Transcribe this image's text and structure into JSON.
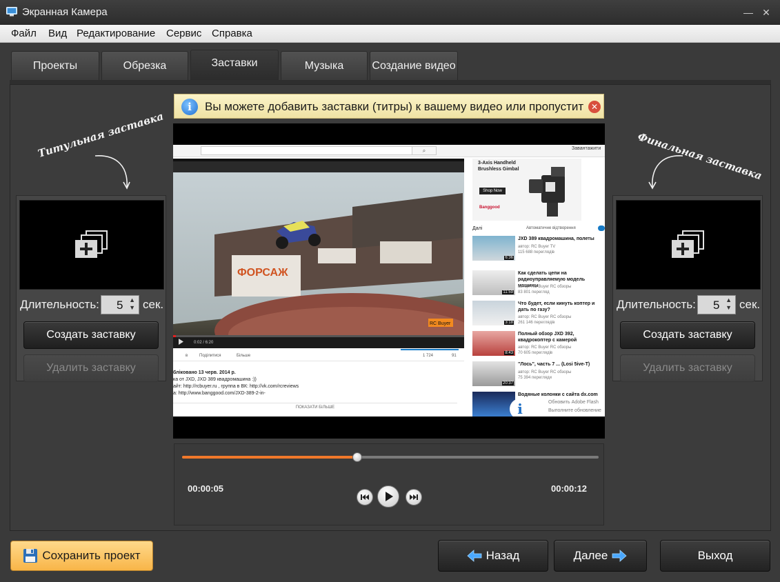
{
  "window": {
    "title": "Экранная Камера"
  },
  "menu": [
    "Файл",
    "Вид",
    "Редактирование",
    "Сервис",
    "Справка"
  ],
  "tabs": [
    {
      "label": "Проекты",
      "active": false
    },
    {
      "label": "Обрезка",
      "active": false
    },
    {
      "label": "Заставки",
      "active": true
    },
    {
      "label": "Музыка",
      "active": false
    },
    {
      "label": "Создание видео",
      "active": false
    }
  ],
  "notice": {
    "text": "Вы можете добавить заставки (титры) к вашему видео или пропустит"
  },
  "left_panel": {
    "heading": "Титульная заставка",
    "duration_label": "Длительность:",
    "duration_value": "5",
    "unit": "сек.",
    "create_label": "Создать заставку",
    "delete_label": "Удалить заставку"
  },
  "right_panel": {
    "heading": "Финальная заставка",
    "duration_label": "Длительность:",
    "duration_value": "5",
    "unit": "сек.",
    "create_label": "Создать заставку",
    "delete_label": "Удалить заставку"
  },
  "video_page": {
    "login": "Завантажити",
    "ad_line1": "3-Axis Handheld",
    "ad_line2": "Brushless Gimbal",
    "ad_shop": "Shop Now",
    "ad_brand": "Banggood",
    "next_label": "Далі",
    "autoplay_label": "Автоматичне відтворення",
    "player_time": "0:02 / 6:20",
    "overlay_brand": "RC Buyer",
    "share_label": "Поділитися",
    "more_label": "Більше",
    "likes": "1 724",
    "dislikes": "91",
    "published": "блiковано 13 черв. 2014 р.",
    "desc1": "ка от JXD, JXD 389 квадромашина :))",
    "desc2": "айт: http://rcbuyer.ru , группа в ВК: http://vk.com/rcreviews",
    "desc3": "а: http://www.banggood.com/JXD-389-2-in-",
    "show_more": "ПОКАЗАТИ БІЛЬШЕ",
    "related": [
      {
        "title": "JXD 389 квадромашина, полеты",
        "meta1": "автор: RC Buyer TV",
        "meta2": "115 688 переглядів",
        "dur": "6:36"
      },
      {
        "title": "Как сделать цепи на радиоуправляемую модель машины",
        "meta1": "автор: RC Buyer RC обзоры",
        "meta2": "83 801 перегляд",
        "dur": "11:59"
      },
      {
        "title": "Что будет, если кинуть коптер и дать по газу?",
        "meta1": "автор: RC Buyer RC обзоры",
        "meta2": "261 146 переглядів",
        "dur": "3:18"
      },
      {
        "title": "Полный обзор JXD 392, квадрокоптер с камерой",
        "meta1": "автор: RC Buyer RC обзоры",
        "meta2": "70 605 переглядів",
        "dur": "8:43"
      },
      {
        "title": "\"Лось\", часть 7 ... (Losi 5ive-T)",
        "meta1": "автор: RC Buyer RC обзоры",
        "meta2": "75 394 перегляди",
        "dur": "20:37"
      },
      {
        "title": "Водяные колонки с сайта dx.com",
        "meta1": "Обновить Adobe Flash",
        "meta2": "Выполните обновление",
        "dur": ""
      }
    ]
  },
  "player": {
    "time_current": "00:00:05",
    "time_total": "00:00:12",
    "progress": 0.42
  },
  "bottom": {
    "save_label": "Сохранить проект",
    "back_label": "Назад",
    "next_label": "Далее",
    "exit_label": "Выход"
  }
}
